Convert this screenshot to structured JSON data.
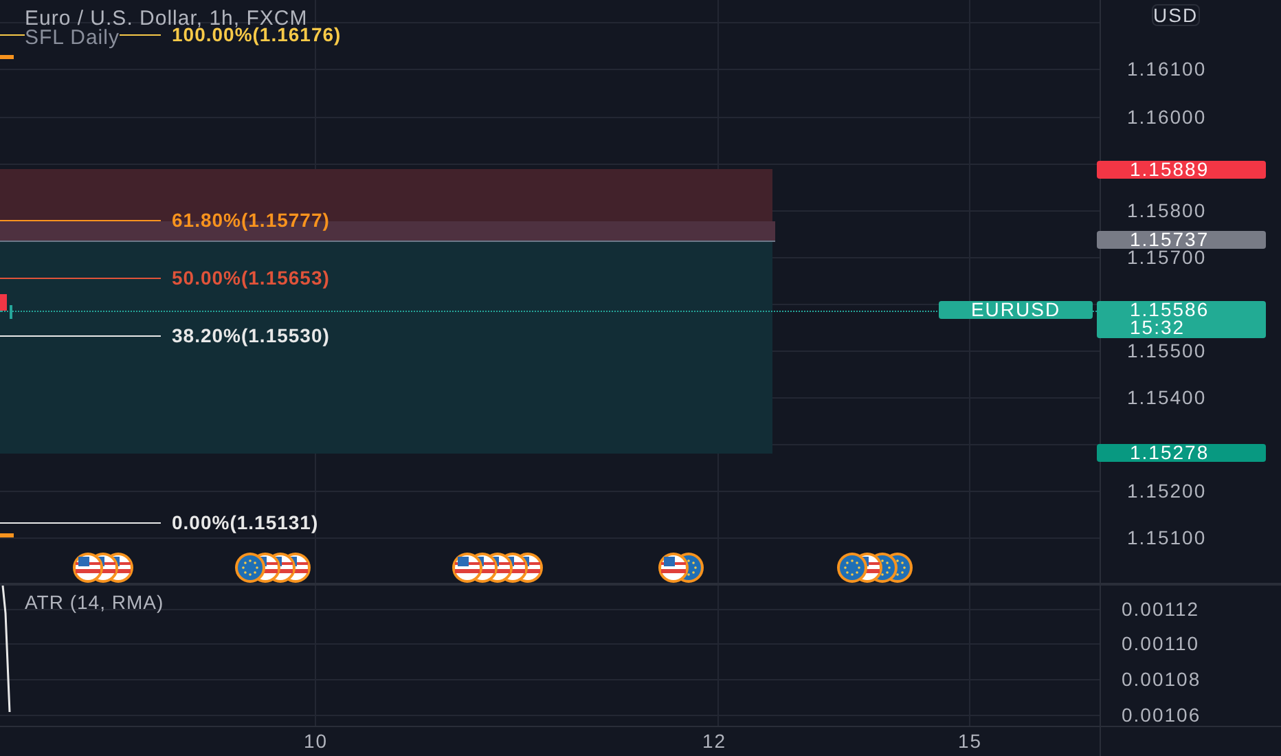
{
  "legend": {
    "title": "Euro / U.S. Dollar, 1h, FXCM",
    "indicator": "SFL Daily"
  },
  "currency_button": "USD",
  "price_axis": [
    "1.16100",
    "1.16000",
    "1.15800",
    "1.15700",
    "1.15500",
    "1.15400",
    "1.15200",
    "1.15100"
  ],
  "fib_levels": [
    {
      "label": "100.00%(1.16176)",
      "color": "#f7c948"
    },
    {
      "label": "61.80%(1.15777)",
      "color": "#f7931e"
    },
    {
      "label": "50.00%(1.15653)",
      "color": "#e0533a"
    },
    {
      "label": "38.20%(1.15530)",
      "color": "#e8e8e8"
    },
    {
      "label": "0.00%(1.15131)",
      "color": "#e8e8e8"
    }
  ],
  "price_tags": [
    {
      "kind": "stop",
      "text": "1.15889"
    },
    {
      "kind": "entry",
      "text": "1.15737"
    },
    {
      "kind": "last",
      "text": "1.15586",
      "countdown": "15:32"
    },
    {
      "kind": "target",
      "text": "1.15278"
    }
  ],
  "symbol_tag": "EURUSD",
  "events": [
    {
      "flags": [
        {
          "kind": "us"
        },
        {
          "kind": "us"
        },
        {
          "kind": "us"
        }
      ]
    },
    {
      "flags": [
        {
          "kind": "eu"
        },
        {
          "kind": "us"
        },
        {
          "kind": "us"
        },
        {
          "kind": "us"
        }
      ]
    },
    {
      "flags": [
        {
          "kind": "us"
        },
        {
          "kind": "us"
        },
        {
          "kind": "us"
        },
        {
          "kind": "us"
        },
        {
          "kind": "us"
        }
      ]
    },
    {
      "flags": [
        {
          "kind": "us"
        },
        {
          "kind": "eu"
        }
      ]
    },
    {
      "flags": [
        {
          "kind": "eu"
        },
        {
          "kind": "us"
        },
        {
          "kind": "eu"
        },
        {
          "kind": "eu"
        }
      ]
    }
  ],
  "atr": {
    "title": "ATR (14, RMA)",
    "axis": [
      "0.00112",
      "0.00110",
      "0.00108",
      "0.00106"
    ]
  },
  "time_axis": [
    "10",
    "12",
    "15"
  ]
}
